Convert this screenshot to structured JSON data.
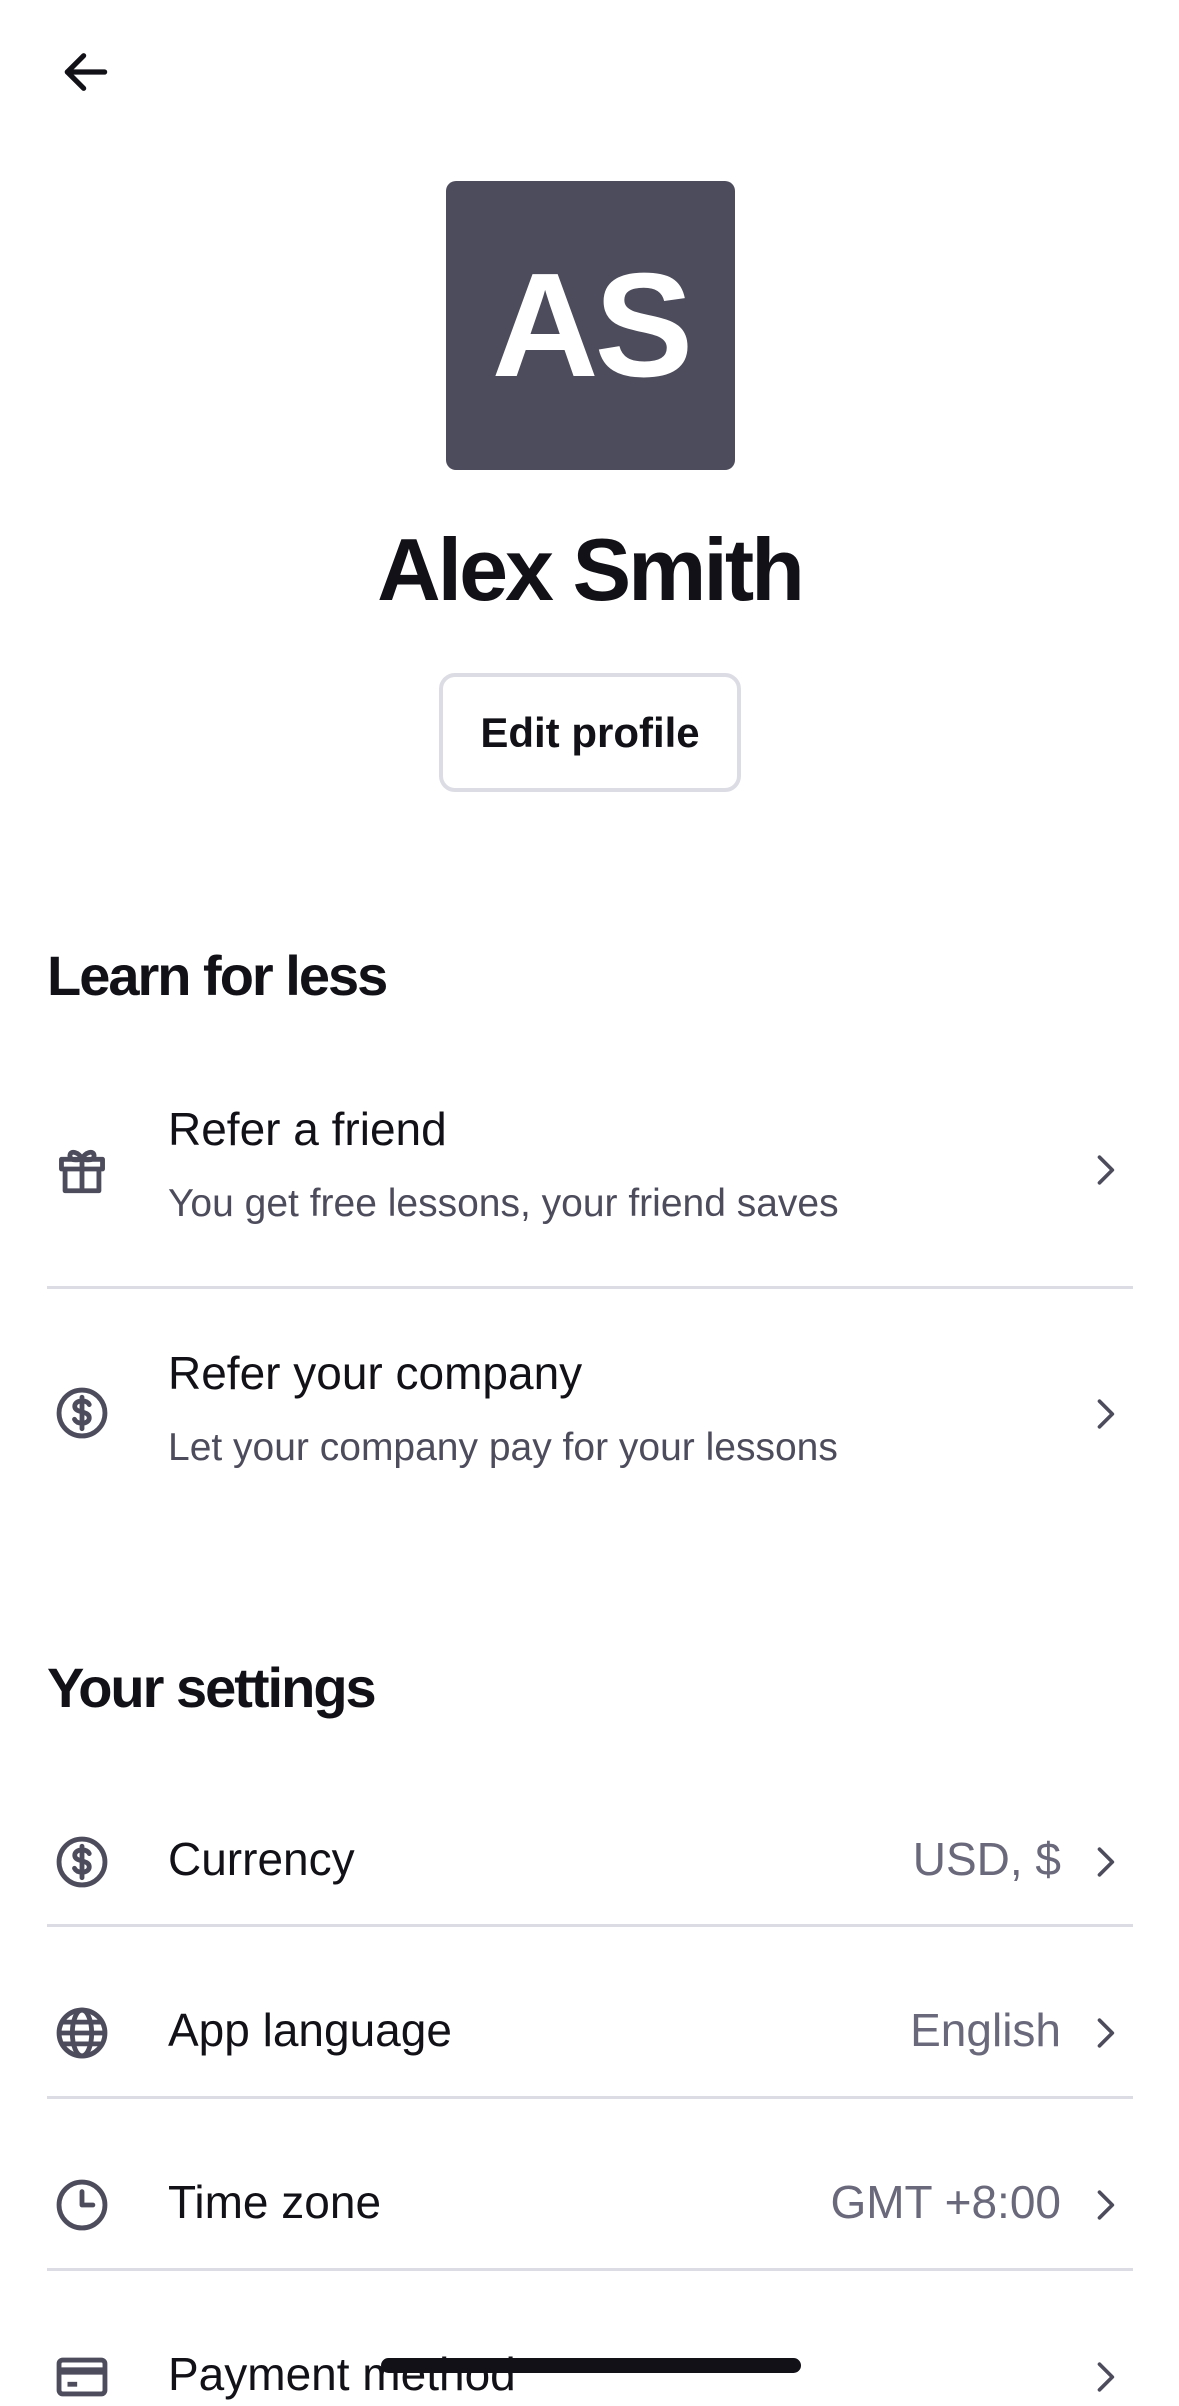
{
  "header": {
    "back_icon": "arrow-left-icon"
  },
  "profile": {
    "initials": "AS",
    "avatar_color": "#4d4c5c",
    "name": "Alex Smith",
    "edit_label": "Edit profile"
  },
  "learn_for_less": {
    "title": "Learn for less",
    "items": [
      {
        "icon": "gift-icon",
        "title": "Refer a friend",
        "subtitle": "You get free lessons, your friend saves"
      },
      {
        "icon": "dollar-circle-icon",
        "title": "Refer your company",
        "subtitle": "Let your company pay for your lessons"
      }
    ]
  },
  "settings": {
    "title": "Your settings",
    "items": [
      {
        "icon": "dollar-circle-icon",
        "label": "Currency",
        "value": "USD, $"
      },
      {
        "icon": "globe-icon",
        "label": "App language",
        "value": "English"
      },
      {
        "icon": "clock-icon",
        "label": "Time zone",
        "value": "GMT +8:00"
      },
      {
        "icon": "credit-card-icon",
        "label": "Payment method",
        "value": ""
      }
    ]
  }
}
